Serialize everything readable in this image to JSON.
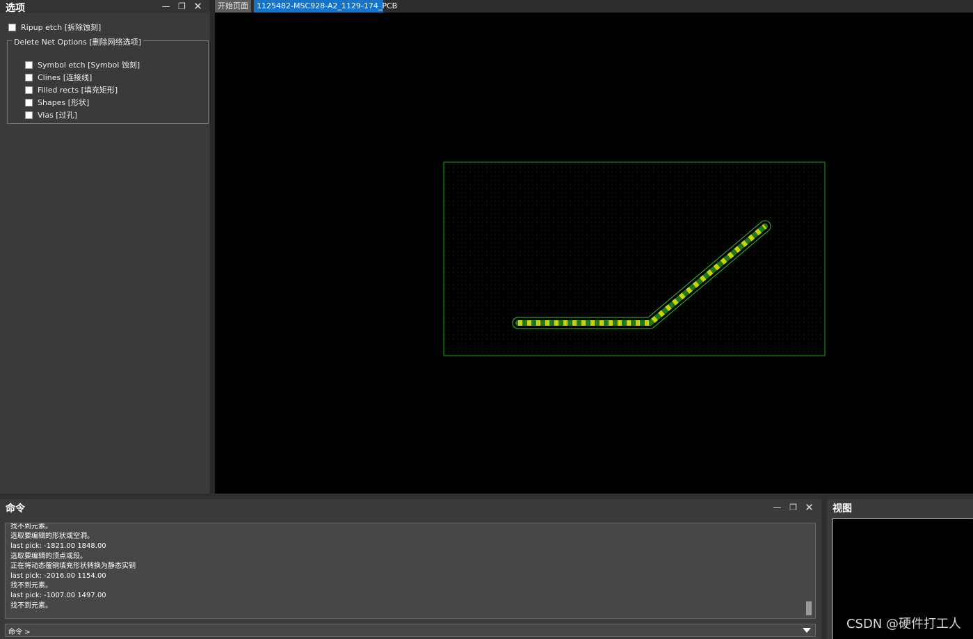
{
  "options_panel": {
    "title": "选项",
    "ripup_etch": "Ripup etch [拆除蚀刻]",
    "group_title": "Delete Net Options [删除网络选项]",
    "items": [
      {
        "label": "Symbol etch [Symbol 蚀刻]",
        "checked": false
      },
      {
        "label": "Clines [连接线]",
        "checked": false
      },
      {
        "label": "Filled rects [填充矩形]",
        "checked": false
      },
      {
        "label": "Shapes [形状]",
        "checked": false
      },
      {
        "label": "Vias [过孔]",
        "checked": false
      }
    ]
  },
  "tabs": {
    "home": "开始页面",
    "active": "1125482-MSC928-A2_1129-174_PCB"
  },
  "command_panel": {
    "title": "命令",
    "log": [
      "找不到元素。",
      "选取要编辑的形状或空洞。",
      "last pick:  -1821.00 1848.00",
      "选取要编辑的顶点或段。",
      "正在将动态覆铜填充形状转换为静态实铜",
      "last pick:  -2016.00 1154.00",
      "找不到元素。",
      "last pick:  -1007.00 1497.00",
      "找不到元素。"
    ],
    "prompt": "命令 >"
  },
  "view_panel": {
    "title": "视图"
  },
  "watermark": "CSDN @硬件打工人",
  "colors": {
    "tab_active": "#1573c9",
    "board_outline": "#1fa51f",
    "trace_yellow": "#c8d400",
    "trace_green": "#1e7a1e"
  },
  "icons": {
    "minimize": "minimize-icon",
    "restore": "restore-icon",
    "close": "close-icon"
  }
}
